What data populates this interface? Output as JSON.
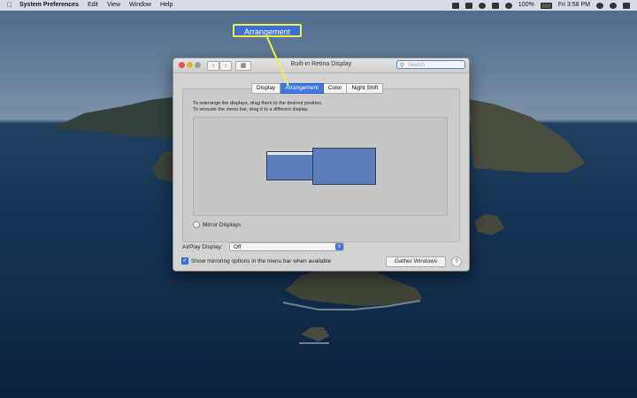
{
  "menubar": {
    "app_name": "System Preferences",
    "items": [
      "Edit",
      "View",
      "Window",
      "Help"
    ],
    "battery": "100%",
    "clock": "Fri 3:58 PM"
  },
  "window": {
    "title": "Built-in Retina Display",
    "search_placeholder": "Search",
    "tabs": [
      {
        "label": "Display",
        "active": false
      },
      {
        "label": "Arrangement",
        "active": true
      },
      {
        "label": "Color",
        "active": false
      },
      {
        "label": "Night Shift",
        "active": false
      }
    ],
    "instructions_line1": "To rearrange the displays, drag them to the desired position.",
    "instructions_line2": "To relocate the menu bar, drag it to a different display.",
    "mirror_label": "Mirror Displays",
    "airplay_label": "AirPlay Display:",
    "airplay_value": "Off",
    "checkbox_label": "Show mirroring options in the menu bar when available",
    "gather_button": "Gather Windows",
    "help_button": "?"
  },
  "callout": {
    "text": "Arrangement"
  },
  "colors": {
    "accent": "#3e79e0",
    "callout_border": "#f1ef4a",
    "display_fill": "#5d7eb8"
  }
}
